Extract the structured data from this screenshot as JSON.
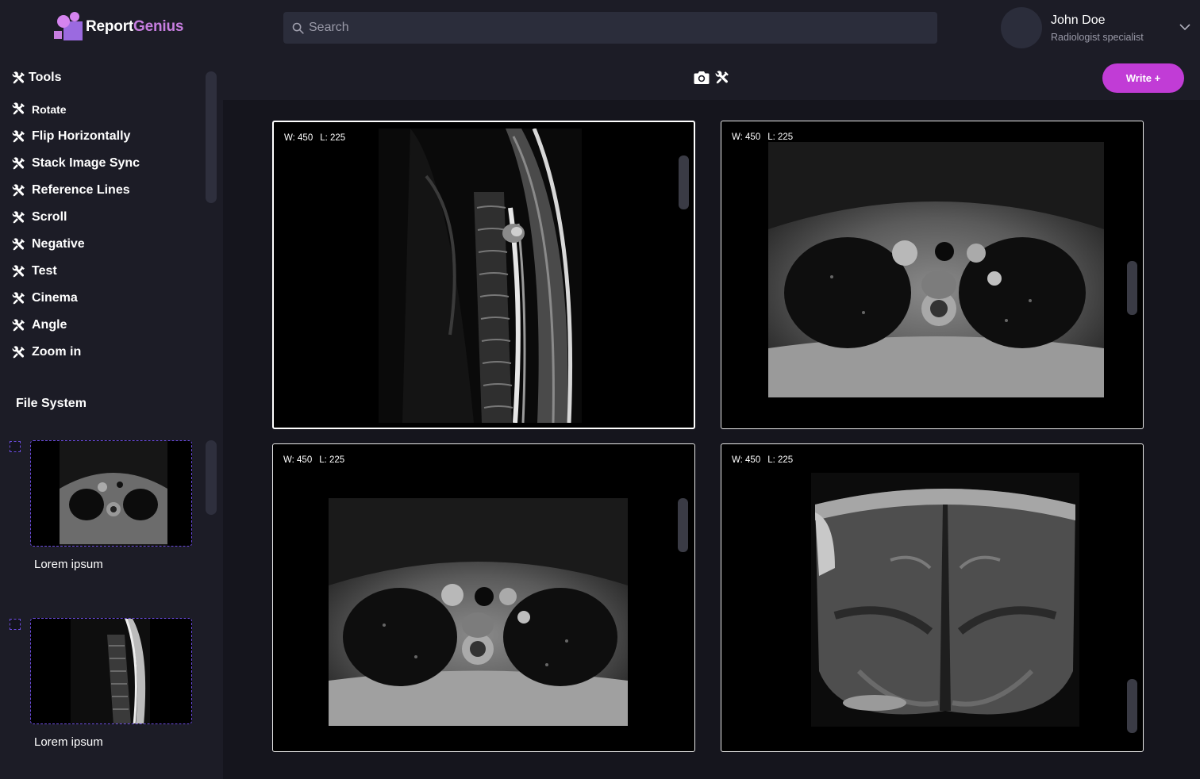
{
  "app": {
    "logo_text_a": "Report",
    "logo_text_b": "Genius"
  },
  "search": {
    "placeholder": "Search"
  },
  "user": {
    "name": "John Doe",
    "role": "Radiologist specialist"
  },
  "tools": {
    "header": "Tools",
    "items": [
      {
        "label": "Rotate"
      },
      {
        "label": "Flip Horizontally"
      },
      {
        "label": "Stack Image Sync"
      },
      {
        "label": "Reference Lines"
      },
      {
        "label": "Scroll"
      },
      {
        "label": "Negative"
      },
      {
        "label": "Test"
      },
      {
        "label": "Cinema"
      },
      {
        "label": "Angle"
      },
      {
        "label": "Zoom in"
      }
    ]
  },
  "file_system": {
    "title": "File System",
    "files": [
      {
        "label": "Lorem ipsum",
        "view": "axial"
      },
      {
        "label": "Lorem ipsum",
        "view": "sagittal"
      }
    ]
  },
  "toolbar": {
    "camera_icon": "camera-icon",
    "tools_icon": "tools-icon",
    "write_label": "Write +"
  },
  "viewports": [
    {
      "w": "W: 450",
      "l": "L: 225",
      "view": "sagittal",
      "active": true
    },
    {
      "w": "W: 450",
      "l": "L: 225",
      "view": "axial",
      "active": false
    },
    {
      "w": "W: 450",
      "l": "L: 225",
      "view": "axial",
      "active": false
    },
    {
      "w": "W: 450",
      "l": "L: 225",
      "view": "coronal",
      "active": false
    }
  ],
  "colors": {
    "background": "#1c1c26",
    "main_background": "#15151d",
    "accent": "#c13cd6",
    "logo_accent": "#c77ee0",
    "dashed_border": "#6a4bdc"
  }
}
